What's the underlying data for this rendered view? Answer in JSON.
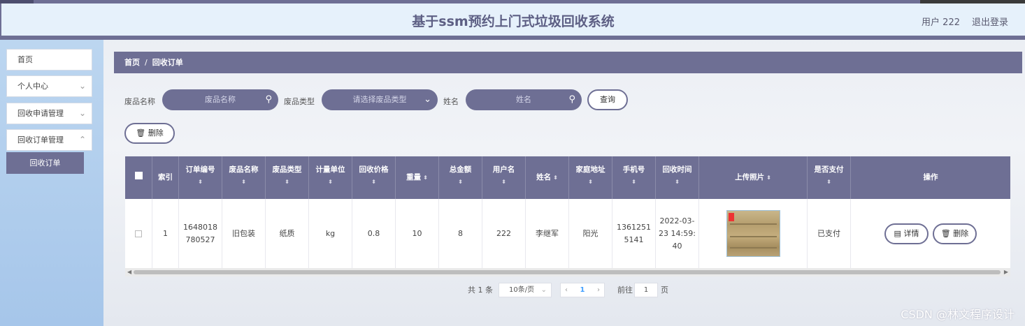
{
  "header": {
    "title": "基于ssm预约上门式垃圾回收系统",
    "user": "用户 222",
    "logout": "退出登录"
  },
  "sidebar": {
    "items": [
      {
        "label": "首页"
      },
      {
        "label": "个人中心"
      },
      {
        "label": "回收申请管理"
      },
      {
        "label": "回收订单管理"
      }
    ],
    "active_sub": "回收订单"
  },
  "breadcrumb": {
    "home": "首页",
    "separator": "/",
    "current": "回收订单"
  },
  "filters": {
    "name_label": "废品名称",
    "name_placeholder": "废品名称",
    "type_label": "废品类型",
    "type_placeholder": "请选择废品类型",
    "person_label": "姓名",
    "person_placeholder": "姓名",
    "search_button": "查询"
  },
  "actions": {
    "delete_button": "删除"
  },
  "table": {
    "headers": [
      "索引",
      "订单编号",
      "废品名称",
      "废品类型",
      "计量单位",
      "回收价格",
      "重量",
      "总金额",
      "用户名",
      "姓名",
      "家庭地址",
      "手机号",
      "回收时间",
      "上传照片",
      "是否支付",
      "操作"
    ],
    "row": {
      "index": "1",
      "order_no": "1648018780527",
      "waste_name": "旧包装",
      "waste_type": "纸质",
      "unit": "kg",
      "price": "0.8",
      "weight": "10",
      "total": "8",
      "username": "222",
      "name": "李继军",
      "address": "阳光",
      "phone": "13612515141",
      "time": "2022-03-23 14:59:40",
      "paid": "已支付",
      "detail_button": "详情",
      "delete_button": "删除"
    }
  },
  "pagination": {
    "total": "共 1 条",
    "page_size": "10条/页",
    "current_page": "1",
    "goto_label": "前往",
    "goto_value": "1",
    "page_unit": "页"
  },
  "watermark": "CSDN @林文程序设计",
  "colors": {
    "primary": "#6e6f94",
    "header_bg": "#e6f1fb",
    "sidebar_bg": "#a6c6ea"
  },
  "icons": [
    "search-icon",
    "chevron-down-icon",
    "trash-icon",
    "document-icon",
    "sort-icon",
    "chevron-left-icon",
    "chevron-right-icon"
  ]
}
